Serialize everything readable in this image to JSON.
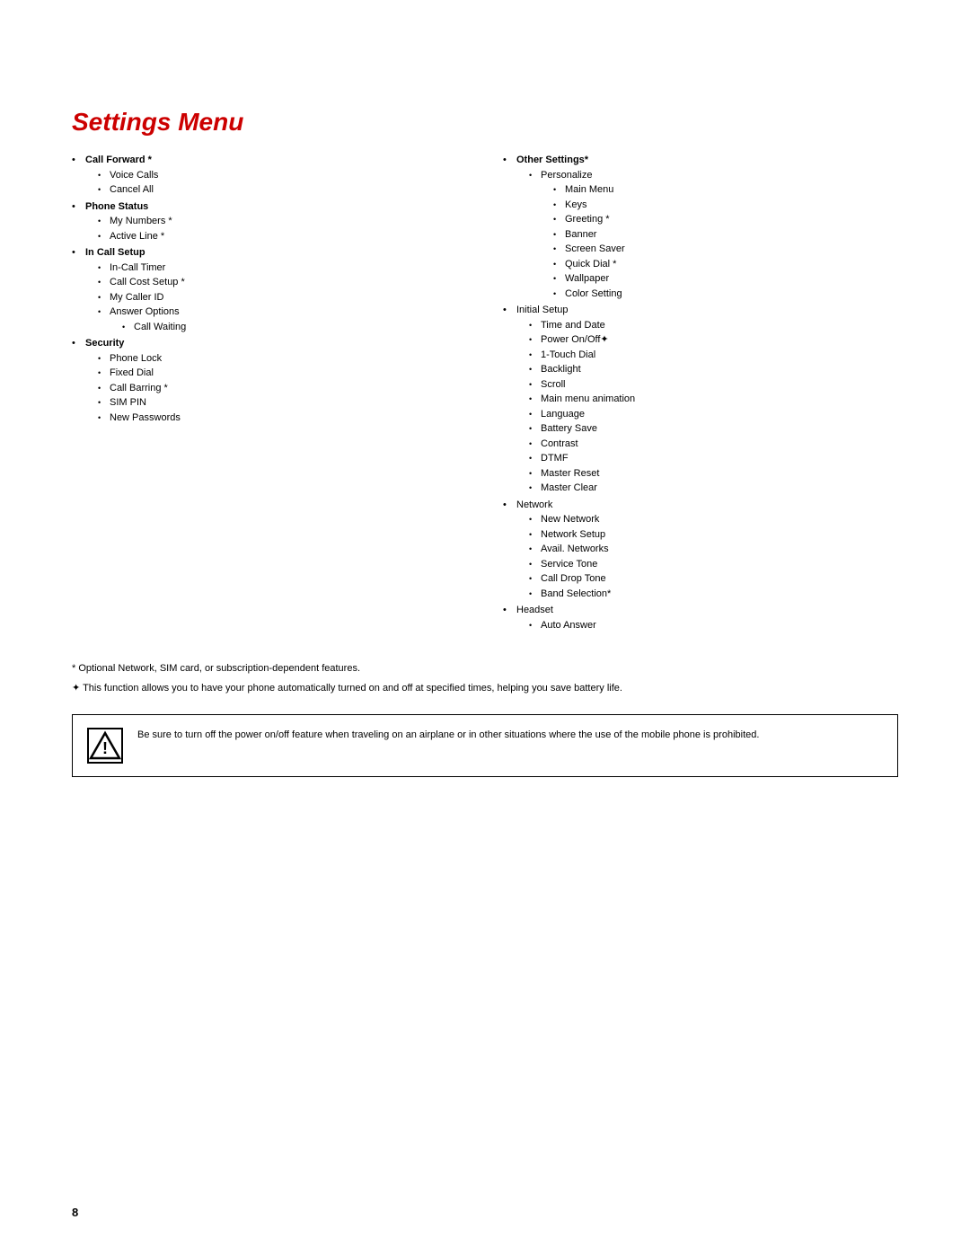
{
  "page": {
    "number": "8",
    "title": "Settings Menu"
  },
  "left_column": {
    "sections": [
      {
        "id": "call-forward",
        "label": "Call Forward *",
        "bold": true,
        "bullet": "•",
        "items": [
          {
            "label": "Voice Calls",
            "bullet": "•"
          },
          {
            "label": "Cancel All",
            "bullet": "•"
          }
        ]
      },
      {
        "id": "phone-status",
        "label": "Phone Status",
        "bold": true,
        "bullet": "•",
        "items": [
          {
            "label": "My Numbers *",
            "bullet": "•"
          },
          {
            "label": "Active Line *",
            "bullet": "•"
          }
        ]
      },
      {
        "id": "in-call-setup",
        "label": "In Call Setup",
        "bold": true,
        "bullet": "•",
        "items": [
          {
            "label": "In-Call Timer",
            "bullet": "•"
          },
          {
            "label": "Call Cost Setup *",
            "bullet": "•"
          },
          {
            "label": "My Caller ID",
            "bullet": "•"
          },
          {
            "label": "Answer Options",
            "bullet": "•",
            "sub": [
              {
                "label": "Call Waiting",
                "bullet": "•"
              }
            ]
          }
        ]
      },
      {
        "id": "security",
        "label": "Security",
        "bold": true,
        "bullet": "•",
        "items": [
          {
            "label": "Phone Lock",
            "bullet": "•"
          },
          {
            "label": "Fixed Dial",
            "bullet": "•"
          },
          {
            "label": "Call Barring *",
            "bullet": "•"
          },
          {
            "label": "SIM PIN",
            "bullet": "•"
          },
          {
            "label": "New Passwords",
            "bullet": "•"
          }
        ]
      }
    ]
  },
  "right_column": {
    "sections": [
      {
        "id": "other-settings",
        "label": "Other Settings*",
        "bold": true,
        "bullet": "•",
        "items": [
          {
            "label": "Personalize",
            "bullet": "•",
            "sub": [
              {
                "label": "Main Menu",
                "bullet": "•"
              },
              {
                "label": "Keys",
                "bullet": "•"
              },
              {
                "label": "Greeting *",
                "bullet": "•"
              },
              {
                "label": "Banner",
                "bullet": "•"
              },
              {
                "label": "Screen Saver",
                "bullet": "•"
              },
              {
                "label": "Quick Dial *",
                "bullet": "•"
              },
              {
                "label": "Wallpaper",
                "bullet": "•"
              },
              {
                "label": "Color Setting",
                "bullet": "•"
              }
            ]
          }
        ]
      },
      {
        "id": "initial-setup",
        "label": "Initial Setup",
        "bold": false,
        "bullet": "•",
        "items": [
          {
            "label": "Time and Date",
            "bullet": "•"
          },
          {
            "label": "Power On/Off✦",
            "bullet": "•"
          },
          {
            "label": "1-Touch Dial",
            "bullet": "•"
          },
          {
            "label": "Backlight",
            "bullet": "•"
          },
          {
            "label": "Scroll",
            "bullet": "•"
          },
          {
            "label": "Main menu animation",
            "bullet": "•"
          },
          {
            "label": "Language",
            "bullet": "•"
          },
          {
            "label": "Battery Save",
            "bullet": "•"
          },
          {
            "label": "Contrast",
            "bullet": "•"
          },
          {
            "label": "DTMF",
            "bullet": "•"
          },
          {
            "label": "Master Reset",
            "bullet": "•"
          },
          {
            "label": "Master Clear",
            "bullet": "•"
          }
        ]
      },
      {
        "id": "network",
        "label": "Network",
        "bold": false,
        "bullet": "•",
        "items": [
          {
            "label": "New Network",
            "bullet": "•"
          },
          {
            "label": "Network Setup",
            "bullet": "•"
          },
          {
            "label": "Avail. Networks",
            "bullet": "•"
          },
          {
            "label": "Service Tone",
            "bullet": "•"
          },
          {
            "label": "Call Drop Tone",
            "bullet": "•"
          },
          {
            "label": "Band Selection*",
            "bullet": "•"
          }
        ]
      },
      {
        "id": "headset",
        "label": "Headset",
        "bold": false,
        "bullet": "•",
        "items": [
          {
            "label": "Auto Answer",
            "bullet": "•"
          }
        ]
      }
    ]
  },
  "footnotes": [
    {
      "symbol": "*",
      "text": "Optional Network, SIM card, or subscription-dependent features."
    },
    {
      "symbol": "✦",
      "text": "This function allows you to have your phone automatically turned on and off at specified times, helping you save battery life."
    }
  ],
  "warning": {
    "icon": "⚠",
    "text": "Be sure to turn off the power on/off feature when traveling on an airplane or in other situations where the use of the mobile phone is prohibited."
  }
}
